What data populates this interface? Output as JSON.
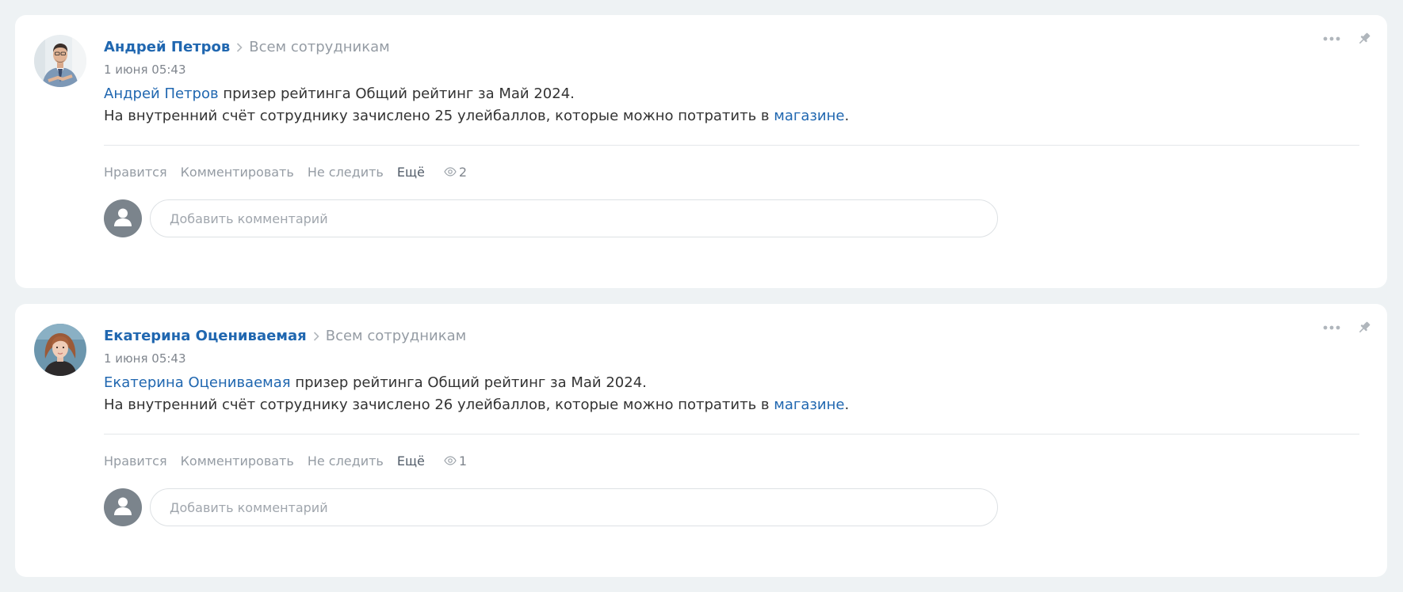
{
  "posts": [
    {
      "author": "Андрей Петров",
      "destination": "Всем сотрудникам",
      "date": "1 июня 05:43",
      "line1_name": "Андрей Петров",
      "line1_text": " призер рейтинга Общий рейтинг за Май 2024.",
      "line2_text": "На внутренний счёт сотруднику зачислено 25 улейбаллов, которые можно потратить в ",
      "line2_link": "магазине",
      "line2_end": ".",
      "actions": {
        "like": "Нравится",
        "comment": "Комментировать",
        "unfollow": "Не следить",
        "more": "Ещё",
        "views": "2"
      },
      "comment_placeholder": "Добавить комментарий",
      "avatar_icon": "avatar-man-photo"
    },
    {
      "author": "Екатерина Оцениваемая",
      "destination": "Всем сотрудникам",
      "date": "1 июня 05:43",
      "line1_name": "Екатерина Оцениваемая",
      "line1_text": " призер рейтинга Общий рейтинг за Май 2024.",
      "line2_text": "На внутренний счёт сотруднику зачислено 26 улейбаллов, которые можно потратить в ",
      "line2_link": "магазине",
      "line2_end": ".",
      "actions": {
        "like": "Нравится",
        "comment": "Комментировать",
        "unfollow": "Не следить",
        "more": "Ещё",
        "views": "1"
      },
      "comment_placeholder": "Добавить комментарий",
      "avatar_icon": "avatar-woman-photo"
    }
  ],
  "icons": {
    "menu": "more-dots-icon",
    "pin": "pin-icon",
    "views": "eye-icon",
    "breadcrumb": "chevron-right-icon",
    "user": "user-silhouette-icon"
  },
  "colors": {
    "link": "#2067b0",
    "muted": "#959ca4",
    "background": "#eef2f4"
  }
}
